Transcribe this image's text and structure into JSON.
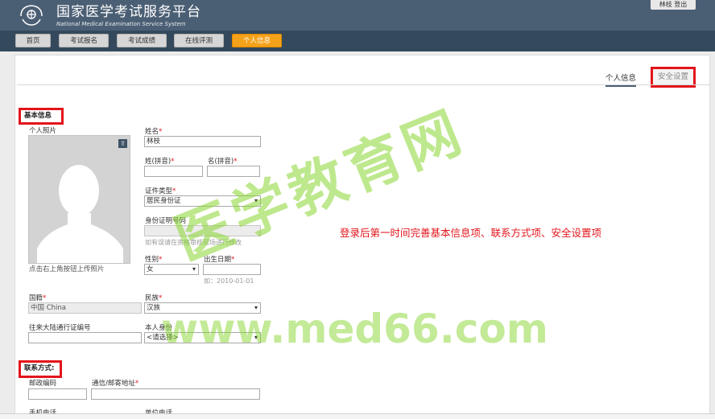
{
  "header": {
    "title": "国家医学考试服务平台",
    "subtitle": "National Medical Examination Service System",
    "user_name": "林枝",
    "logout_label": "登出"
  },
  "nav": {
    "items": [
      {
        "label": "首页",
        "active": false
      },
      {
        "label": "考试报名",
        "active": false
      },
      {
        "label": "考试成绩",
        "active": false
      },
      {
        "label": "在线评测",
        "active": false
      },
      {
        "label": "个人信息",
        "active": true
      }
    ]
  },
  "tabs": {
    "personal": "个人信息",
    "security": "安全设置"
  },
  "basic": {
    "section_title": "基本信息",
    "photo_label": "个人照片",
    "photo_hint": "点击右上角按钮上传照片",
    "name_label": "姓名",
    "name_value": "林枝",
    "surname_pinyin_label": "姓(拼音)",
    "given_pinyin_label": "名(拼音)",
    "id_type_label": "证件类型",
    "id_type_value": "居民身份证",
    "id_number_label": "身份证明号码",
    "id_hint": "如有误请在资格审核现场进行修改",
    "gender_label": "性别",
    "gender_value": "女",
    "birth_label": "出生日期",
    "birth_hint": "如：2010-01-01",
    "nationality_label": "国籍",
    "nationality_value": "中国 China",
    "ethnicity_label": "民族",
    "ethnicity_value": "汉族",
    "mainland_permit_label": "往来大陆通行证编号",
    "identity_label": "本人身份",
    "identity_value": "<请选择>"
  },
  "contact": {
    "section_title": "联系方式:",
    "postcode_label": "邮政编码",
    "address_label": "通信/邮寄地址",
    "mobile_label": "手机电话",
    "work_phone_label": "单位电话"
  },
  "annotation": {
    "note": "登录后第一时间完善基本信息项、联系方式项、安全设置项",
    "watermark_cn": "医学教育网",
    "watermark_en": "www.med66.com"
  },
  "colors": {
    "header_bg": "#4b5f74",
    "nav_bg": "#34495c",
    "active_tab": "#f5a21b",
    "highlight": "#e3141b",
    "watermark": "#88d630"
  }
}
